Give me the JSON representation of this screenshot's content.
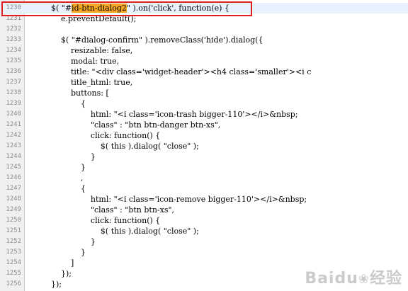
{
  "editor": {
    "highlight_token": "id-btn-dialog2",
    "lines": [
      {
        "num": "1230",
        "pre": "        $( \"#",
        "hl": "id-btn-dialog2",
        "post": "\" ).on('click', function(e) {"
      },
      {
        "num": "1231",
        "pre": "            e.preventDefault();",
        "hl": "",
        "post": ""
      },
      {
        "num": "1232",
        "pre": "",
        "hl": "",
        "post": ""
      },
      {
        "num": "1233",
        "pre": "            $( \"#dialog-confirm\" ).removeClass('hide').dialog({",
        "hl": "",
        "post": ""
      },
      {
        "num": "1234",
        "pre": "                resizable: false,",
        "hl": "",
        "post": ""
      },
      {
        "num": "1235",
        "pre": "                modal: true,",
        "hl": "",
        "post": ""
      },
      {
        "num": "1236",
        "pre": "                title: \"<div class='widget-header'><h4 class='smaller'><i c",
        "hl": "",
        "post": ""
      },
      {
        "num": "1237",
        "pre": "                title_html: true,",
        "hl": "",
        "post": ""
      },
      {
        "num": "1238",
        "pre": "                buttons: [",
        "hl": "",
        "post": ""
      },
      {
        "num": "1239",
        "pre": "                    {",
        "hl": "",
        "post": ""
      },
      {
        "num": "1240",
        "pre": "                        html: \"<i class='icon-trash bigger-110'></i>&nbsp;",
        "hl": "",
        "post": ""
      },
      {
        "num": "1241",
        "pre": "                        \"class\" : \"btn btn-danger btn-xs\",",
        "hl": "",
        "post": ""
      },
      {
        "num": "1242",
        "pre": "                        click: function() {",
        "hl": "",
        "post": ""
      },
      {
        "num": "1243",
        "pre": "                            $( this ).dialog( \"close\" );",
        "hl": "",
        "post": ""
      },
      {
        "num": "1244",
        "pre": "                        }",
        "hl": "",
        "post": ""
      },
      {
        "num": "1245",
        "pre": "                    }",
        "hl": "",
        "post": ""
      },
      {
        "num": "1246",
        "pre": "                    ,",
        "hl": "",
        "post": ""
      },
      {
        "num": "1247",
        "pre": "                    {",
        "hl": "",
        "post": ""
      },
      {
        "num": "1248",
        "pre": "                        html: \"<i class='icon-remove bigger-110'></i>&nbsp;",
        "hl": "",
        "post": ""
      },
      {
        "num": "1249",
        "pre": "                        \"class\" : \"btn btn-xs\",",
        "hl": "",
        "post": ""
      },
      {
        "num": "1250",
        "pre": "                        click: function() {",
        "hl": "",
        "post": ""
      },
      {
        "num": "1251",
        "pre": "                            $( this ).dialog( \"close\" );",
        "hl": "",
        "post": ""
      },
      {
        "num": "1252",
        "pre": "                        }",
        "hl": "",
        "post": ""
      },
      {
        "num": "1253",
        "pre": "                    }",
        "hl": "",
        "post": ""
      },
      {
        "num": "1254",
        "pre": "                ]",
        "hl": "",
        "post": ""
      },
      {
        "num": "1255",
        "pre": "            });",
        "hl": "",
        "post": ""
      },
      {
        "num": "1256",
        "pre": "        });",
        "hl": "",
        "post": ""
      }
    ]
  },
  "watermark": {
    "text": "Baidu",
    "suffix": "经验"
  },
  "colors": {
    "highlight": "#f5a623",
    "annotation_box": "#e02020"
  }
}
